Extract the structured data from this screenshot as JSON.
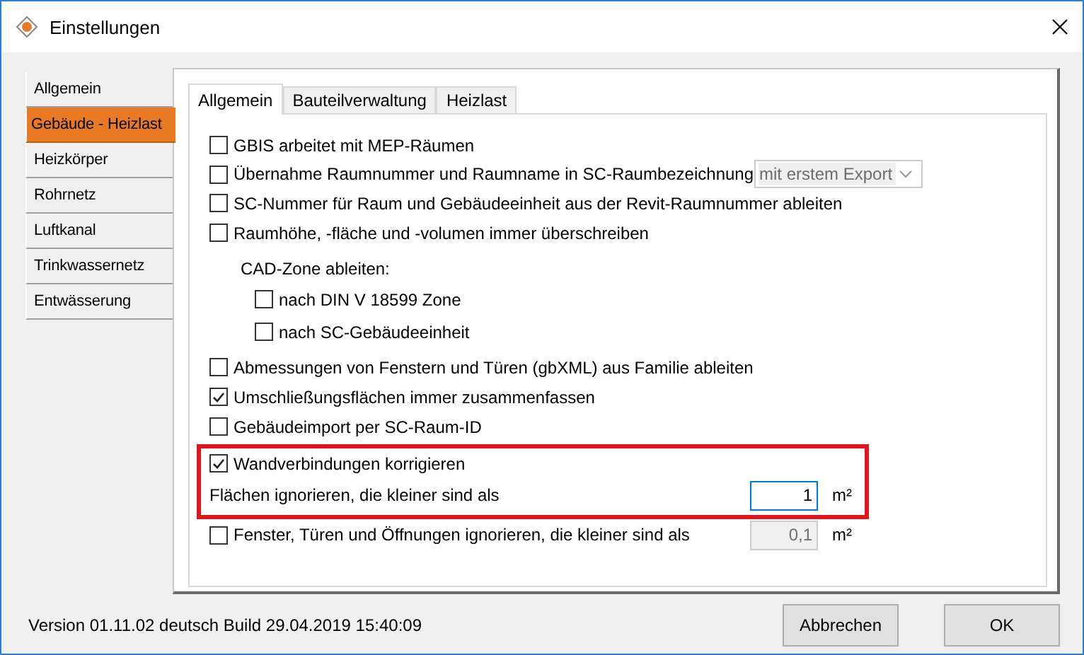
{
  "window": {
    "title": "Einstellungen"
  },
  "sidebar": {
    "items": [
      {
        "label": "Allgemein",
        "selected": false
      },
      {
        "label": "Gebäude - Heizlast",
        "selected": true
      },
      {
        "label": "Heizkörper",
        "selected": false
      },
      {
        "label": "Rohrnetz",
        "selected": false
      },
      {
        "label": "Luftkanal",
        "selected": false
      },
      {
        "label": "Trinkwassernetz",
        "selected": false
      },
      {
        "label": "Entwässerung",
        "selected": false
      }
    ]
  },
  "tabs": [
    {
      "label": "Allgemein",
      "selected": true
    },
    {
      "label": "Bauteilverwaltung",
      "selected": false
    },
    {
      "label": "Heizlast",
      "selected": false
    }
  ],
  "options": [
    {
      "kind": "checkbox",
      "label": "GBIS arbeitet mit MEP-Räumen",
      "checked": false
    },
    {
      "kind": "checkbox_select",
      "label": "Übernahme Raumnummer und Raumname in SC-Raumbezeichnung",
      "checked": false,
      "select": {
        "value": "mit erstem Export",
        "disabled": true
      }
    },
    {
      "kind": "checkbox",
      "label": "SC-Nummer für Raum und Gebäudeeinheit aus der Revit-Raumnummer ableiten",
      "checked": false
    },
    {
      "kind": "checkbox",
      "label": "Raumhöhe, -fläche und -volumen immer überschreiben",
      "checked": false
    },
    {
      "kind": "subgroup",
      "label": "CAD-Zone ableiten:",
      "items": [
        {
          "label": "nach DIN V 18599 Zone",
          "checked": false
        },
        {
          "label": "nach SC-Gebäudeeinheit",
          "checked": false
        }
      ]
    },
    {
      "kind": "checkbox",
      "label": "Abmessungen von Fenstern und Türen (gbXML) aus Familie ableiten",
      "checked": false
    },
    {
      "kind": "checkbox",
      "label": "Umschließungsflächen immer zusammenfassen",
      "checked": true
    },
    {
      "kind": "checkbox",
      "label": "Gebäudeimport per SC-Raum-ID",
      "checked": false
    },
    {
      "kind": "group",
      "highlighted": true,
      "items": [
        {
          "kind": "checkbox",
          "label": "Wandverbindungen korrigieren",
          "checked": true
        },
        {
          "kind": "number",
          "label": "Flächen ignorieren, die kleiner sind als",
          "field": {
            "value": "1",
            "disabled": false,
            "focused": true
          },
          "unit": "m²"
        }
      ]
    },
    {
      "kind": "checkbox_number",
      "label": "Fenster, Türen und Öffnungen ignorieren, die kleiner sind als",
      "checked": false,
      "field": {
        "value": "0,1",
        "disabled": true,
        "focused": false
      },
      "unit": "m²"
    }
  ],
  "status": {
    "version": "Version 01.11.02 deutsch Build 29.04.2019 15:40:09"
  },
  "buttons": [
    {
      "label": "Abbrechen",
      "default": false
    },
    {
      "label": "OK",
      "default": false
    }
  ]
}
